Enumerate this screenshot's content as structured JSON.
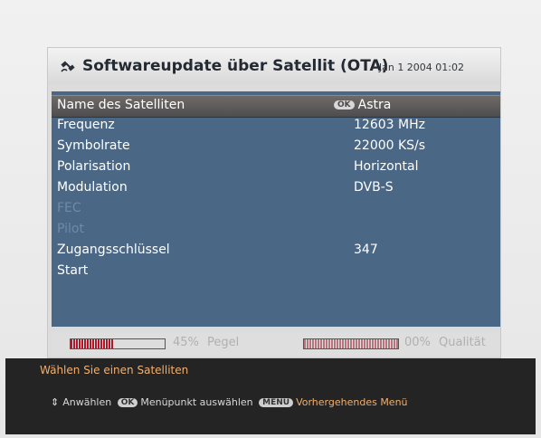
{
  "header": {
    "title": "Softwareupdate über Satellit (OTA)",
    "datetime": "Jan 1 2004 01:02"
  },
  "settings": [
    {
      "label": "Name des Satelliten",
      "value": "Astra",
      "selected": true,
      "disabled": false,
      "ok_badge": "OK"
    },
    {
      "label": "Frequenz",
      "value": "12603 MHz",
      "selected": false,
      "disabled": false
    },
    {
      "label": "Symbolrate",
      "value": "22000 KS/s",
      "selected": false,
      "disabled": false
    },
    {
      "label": "Polarisation",
      "value": "Horizontal",
      "selected": false,
      "disabled": false
    },
    {
      "label": "Modulation",
      "value": "DVB-S",
      "selected": false,
      "disabled": false
    },
    {
      "label": "FEC",
      "value": "",
      "selected": false,
      "disabled": true
    },
    {
      "label": "Pilot",
      "value": "",
      "selected": false,
      "disabled": true
    },
    {
      "label": "Zugangsschlüssel",
      "value": "347",
      "selected": false,
      "disabled": false
    },
    {
      "label": "Start",
      "value": "",
      "selected": false,
      "disabled": false
    }
  ],
  "meters": {
    "pegel": {
      "percent_text": "45%",
      "label": "Pegel",
      "level": 0.45
    },
    "qualitaet": {
      "percent_text": "00%",
      "label": "Qualität",
      "level": 0.0
    }
  },
  "status": {
    "hint": "Wählen Sie einen Satelliten"
  },
  "legend": {
    "select": "Anwählen",
    "ok_button": "OK",
    "menu_select": "Menüpunkt auswählen",
    "menu_button": "MENU",
    "previous_menu": "Vorhergehendes Menü"
  },
  "colors": {
    "panel": "#4a6786",
    "selected_row": "#5e5a58",
    "meter_fill": "#b0182a",
    "hint_text": "#f0b070"
  },
  "icons": {
    "title": "satellite-icon",
    "navigate": "up-down-arrows-icon"
  }
}
